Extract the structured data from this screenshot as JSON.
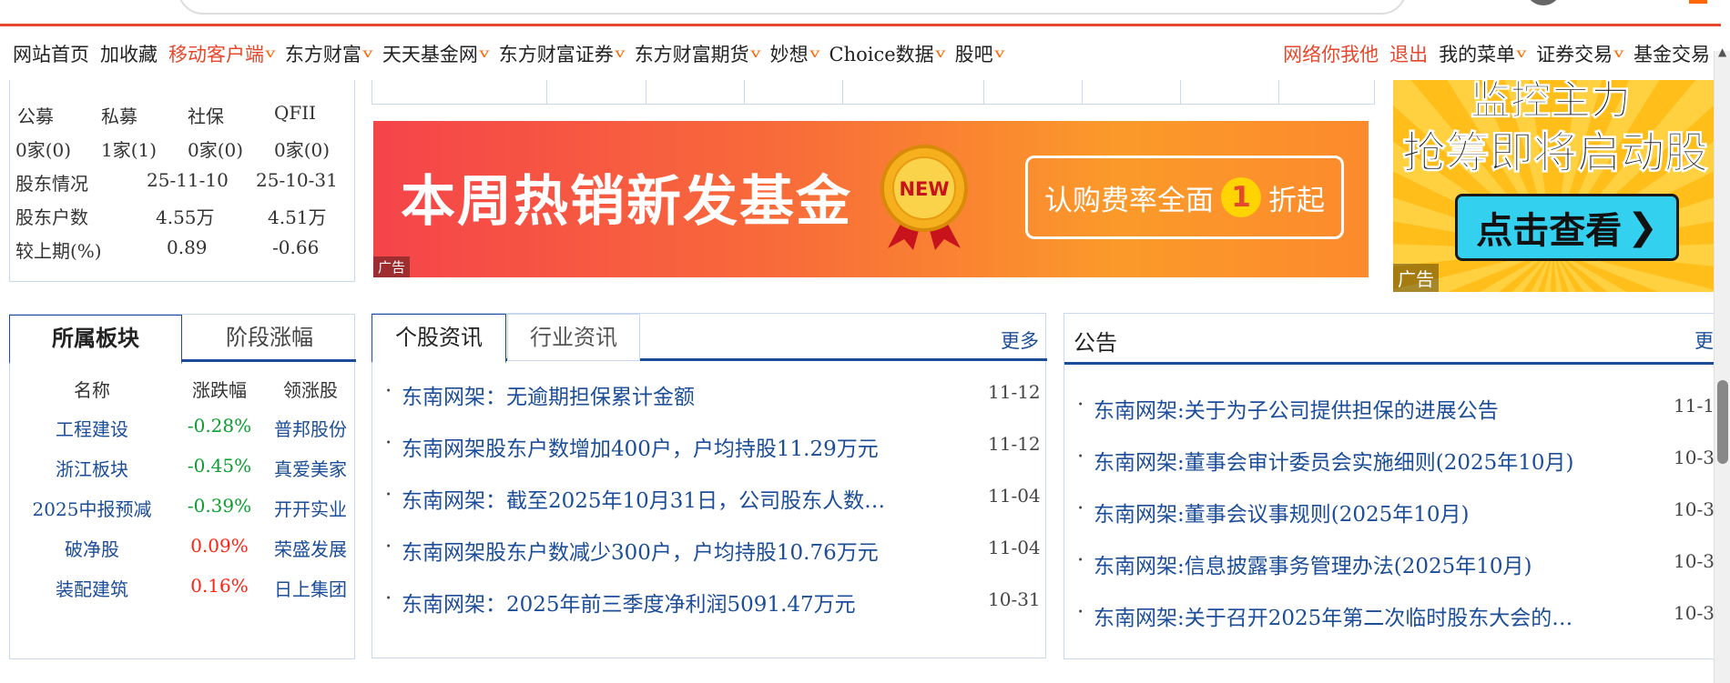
{
  "nav": {
    "left": [
      {
        "label": "网站首页",
        "orange": false,
        "chevron": false
      },
      {
        "label": "加收藏",
        "orange": false,
        "chevron": false
      },
      {
        "label": "移动客户端",
        "orange": true,
        "chevron": true
      },
      {
        "label": "东方财富",
        "orange": false,
        "chevron": true
      },
      {
        "label": "天天基金网",
        "orange": false,
        "chevron": true
      },
      {
        "label": "东方财富证券",
        "orange": false,
        "chevron": true
      },
      {
        "label": "东方财富期货",
        "orange": false,
        "chevron": true
      },
      {
        "label": "妙想",
        "orange": false,
        "chevron": true
      },
      {
        "label": "Choice数据",
        "orange": false,
        "chevron": true
      },
      {
        "label": "股吧",
        "orange": false,
        "chevron": true
      }
    ],
    "right": [
      {
        "label": "网络你我他",
        "orange": true,
        "chevron": false
      },
      {
        "label": "退出",
        "orange": true,
        "chevron": false
      },
      {
        "label": "我的菜单",
        "orange": false,
        "chevron": true
      },
      {
        "label": "证券交易",
        "orange": false,
        "chevron": true
      },
      {
        "label": "基金交易",
        "orange": false,
        "chevron": false
      }
    ],
    "chevron_glyph": "v"
  },
  "holders": {
    "inst_headers": [
      "公募",
      "私募",
      "社保",
      "QFII"
    ],
    "inst_values": [
      "0家(0)",
      "1家(1)",
      "0家(0)",
      "0家(0)"
    ],
    "rows": [
      {
        "label": "股东情况",
        "v1": "25-11-10",
        "v2": "25-10-31"
      },
      {
        "label": "股东户数",
        "v1": "4.55万",
        "v2": "4.51万"
      },
      {
        "label": "较上期(%)",
        "v1": "0.89",
        "v2": "-0.66"
      }
    ]
  },
  "ad_main": {
    "title": "本周热销新发基金",
    "badge": "NEW",
    "promo_prefix": "认购费率全面",
    "promo_num": "1",
    "promo_suffix": "折起",
    "tag": "广告"
  },
  "ad_right": {
    "line1": "监控主力",
    "line2": "抢筹即将启动股",
    "button": "点击查看",
    "tag": "广告"
  },
  "sector": {
    "tabs": [
      "所属板块",
      "阶段涨幅"
    ],
    "headers": [
      "名称",
      "涨跌幅",
      "领涨股"
    ],
    "rows": [
      {
        "name": "工程建设",
        "change": "-0.28%",
        "leader": "普邦股份",
        "up": false
      },
      {
        "name": "浙江板块",
        "change": "-0.45%",
        "leader": "真爱美家",
        "up": false
      },
      {
        "name": "2025中报预减",
        "change": "-0.39%",
        "leader": "开开实业",
        "up": false
      },
      {
        "name": "破净股",
        "change": "0.09%",
        "leader": "荣盛发展",
        "up": true
      },
      {
        "name": "装配建筑",
        "change": "0.16%",
        "leader": "日上集团",
        "up": true
      }
    ]
  },
  "news": {
    "tabs": [
      "个股资讯",
      "行业资讯"
    ],
    "more": "更多",
    "items": [
      {
        "title": "东南网架：无逾期担保累计金额",
        "date": "11-12"
      },
      {
        "title": "东南网架股东户数增加400户，户均持股11.29万元",
        "date": "11-12"
      },
      {
        "title": "东南网架：截至2025年10月31日，公司股东人数…",
        "date": "11-04"
      },
      {
        "title": "东南网架股东户数减少300户，户均持股10.76万元",
        "date": "11-04"
      },
      {
        "title": "东南网架：2025年前三季度净利润5091.47万元",
        "date": "10-31"
      }
    ]
  },
  "announcements": {
    "title": "公告",
    "more": "更",
    "items": [
      {
        "title": "东南网架:关于为子公司提供担保的进展公告",
        "date": "11-1"
      },
      {
        "title": "东南网架:董事会审计委员会实施细则(2025年10月)",
        "date": "10-3"
      },
      {
        "title": "东南网架:董事会议事规则(2025年10月)",
        "date": "10-3"
      },
      {
        "title": "东南网架:信息披露事务管理办法(2025年10月)",
        "date": "10-3"
      },
      {
        "title": "东南网架:关于召开2025年第二次临时股东大会的…",
        "date": "10-3"
      }
    ]
  },
  "colors": {
    "accent": "#e5482d",
    "link": "#1b4d98",
    "up": "#ff2211",
    "down": "#0a9f2e"
  }
}
